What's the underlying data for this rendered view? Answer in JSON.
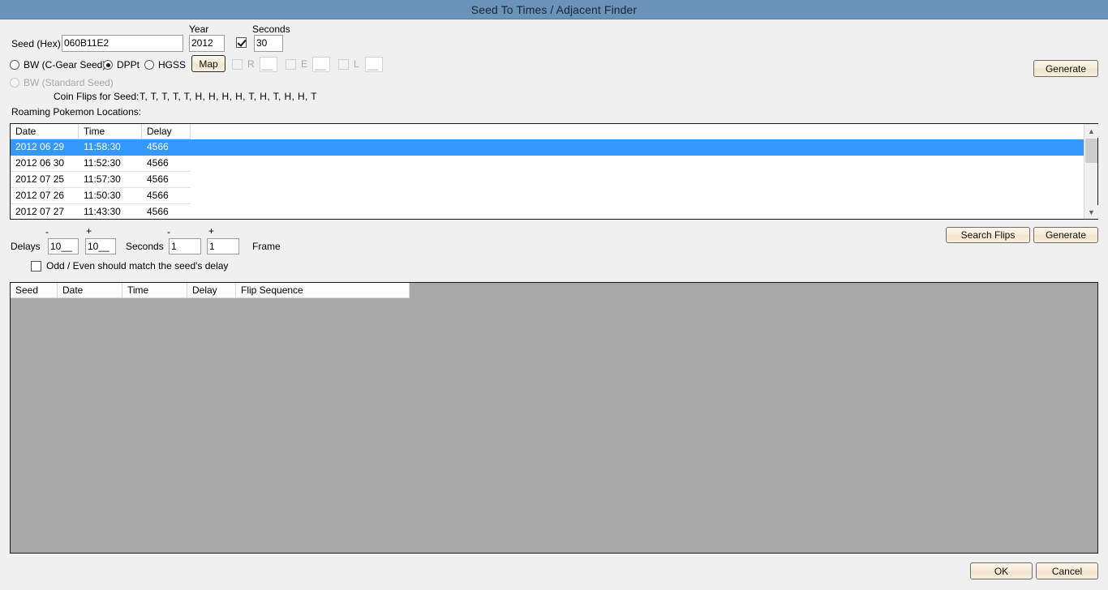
{
  "window": {
    "title": "Seed To Times / Adjacent Finder"
  },
  "seed_panel": {
    "seed_label": "Seed (Hex)",
    "seed_value": "060B11E2",
    "year_label": "Year",
    "year_value": "2012",
    "seconds_label": "Seconds",
    "seconds_enabled": true,
    "seconds_value": "30",
    "generate_label": "Generate"
  },
  "game_modes": {
    "bw_cgear": "BW (C-Gear Seed)",
    "dppt": "DPPt",
    "hgss": "HGSS",
    "bw_standard": "BW (Standard Seed)",
    "map_button": "Map",
    "selected": "DPPt"
  },
  "keypress": {
    "r_label": "R",
    "r_value": "__",
    "e_label": "E",
    "e_value": "__",
    "l_label": "L",
    "l_value": "__"
  },
  "coin_flips": {
    "label": "Coin Flips for Seed:",
    "value": "T, T, T, T, T, H, H, H, H, T, H, T, H, H, T"
  },
  "roaming": {
    "label": "Roaming Pokemon Locations:",
    "columns": [
      "Date",
      "Time",
      "Delay"
    ],
    "rows": [
      {
        "date": "2012 06 29",
        "time": "11:58:30",
        "delay": "4566",
        "selected": true
      },
      {
        "date": "2012 06 30",
        "time": "11:52:30",
        "delay": "4566",
        "selected": false
      },
      {
        "date": "2012 07 25",
        "time": "11:57:30",
        "delay": "4566",
        "selected": false
      },
      {
        "date": "2012 07 26",
        "time": "11:50:30",
        "delay": "4566",
        "selected": false
      },
      {
        "date": "2012 07 27",
        "time": "11:43:30",
        "delay": "4566",
        "selected": false
      }
    ]
  },
  "search_controls": {
    "delays_label": "Delays",
    "delay_minus_sign": "-",
    "delay_plus_sign": "+",
    "delay_minus_value": "10__",
    "delay_plus_value": "10__",
    "seconds_label": "Seconds",
    "seconds_minus_sign": "-",
    "seconds_plus_sign": "+",
    "seconds_minus_value": "1",
    "seconds_plus_value": "1",
    "frame_label": "Frame",
    "odd_even_label": "Odd / Even should match the seed's delay",
    "odd_even_checked": false,
    "search_flips_label": "Search Flips",
    "generate_label": "Generate"
  },
  "results": {
    "columns": [
      "Seed",
      "Date",
      "Time",
      "Delay",
      "Flip Sequence"
    ],
    "rows": []
  },
  "dialog_buttons": {
    "ok_label": "OK",
    "cancel_label": "Cancel"
  },
  "colors": {
    "titlebar": "#6b92b9",
    "selection": "#3399ff",
    "button_face": "#f6ecd8",
    "panel_bg": "#f0f0f0",
    "listview_bg": "#a8a8a8"
  }
}
